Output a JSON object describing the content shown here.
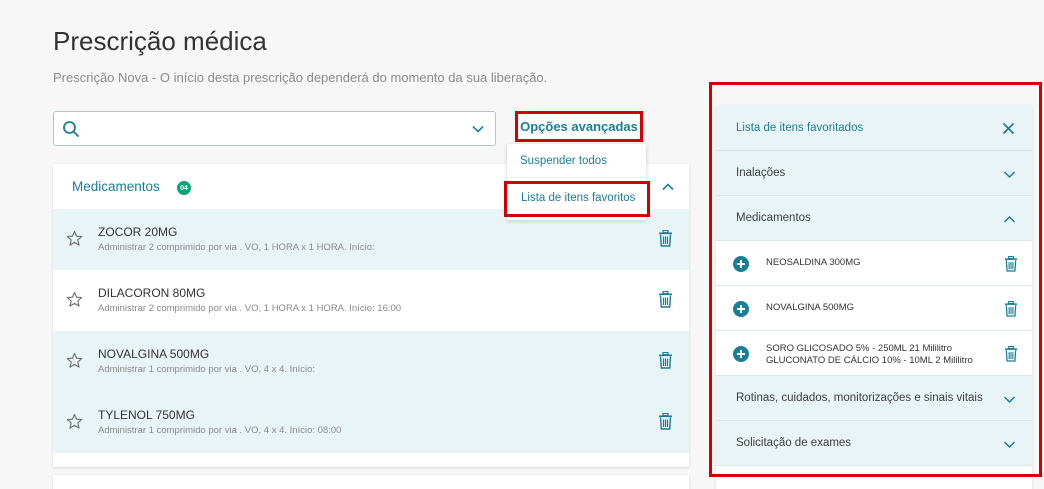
{
  "page": {
    "title": "Prescrição médica",
    "subtitle": "Prescrição Nova - O início desta prescrição dependerá do momento da sua liberação."
  },
  "search": {
    "value": "",
    "placeholder": ""
  },
  "advanced_options": {
    "label": "Opções avançadas",
    "menu": [
      "Suspender todos",
      "Lista de itens favoritos"
    ]
  },
  "medications_card": {
    "title": "Medicamentos",
    "count": "04",
    "rows": [
      {
        "name": "ZOCOR 20MG",
        "desc": "Administrar 2 comprimido por via . VO, 1 HORA x 1 HORA. Início:"
      },
      {
        "name": "DILACORON 80MG",
        "desc": "Administrar 2 comprimido por via . VO, 1 HORA x 1 HORA. Início: 16:00"
      },
      {
        "name": "NOVALGINA 500MG",
        "desc": "Administrar 1 comprimido por via . VO, 4 x 4. Início:"
      },
      {
        "name": "TYLENOL 750MG",
        "desc": "Administrar 1 comprimido por via . VO, 4 x 4. Início: 08:00"
      }
    ]
  },
  "favorites_panel": {
    "title": "Lista de itens favoritados",
    "sections": {
      "inhalations": "Inalações",
      "medications": "Medicamentos",
      "routines": "Rotinas, cuidados, monitorizações e sinais vitais",
      "exams": "Solicitação de exames"
    },
    "medication_items": [
      {
        "line1": "NEOSALDINA 300MG"
      },
      {
        "line1": "NOVALGINA 500MG"
      },
      {
        "line1": "SORO GLICOSADO 5% - 250ML 21 Mililitro",
        "line2": "GLUCONATO DE CÁLCIO 10% - 10ML 2 Mililitro"
      }
    ]
  },
  "colors": {
    "accent": "#1b7d96",
    "highlight_border": "#d40000",
    "row_shade": "#e9f4f7",
    "badge": "#0da47a"
  },
  "icons": [
    "search-icon",
    "chevron-down-icon",
    "chevron-up-icon",
    "star-icon",
    "trash-icon",
    "close-icon",
    "plus-circle-icon"
  ]
}
